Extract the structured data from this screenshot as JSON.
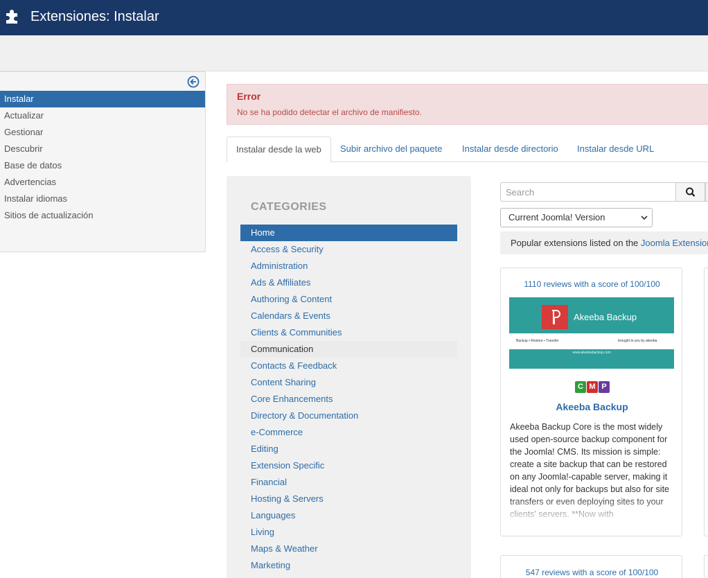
{
  "header": {
    "title": "Extensiones: Instalar",
    "icon": "puzzle-icon"
  },
  "sidebar": {
    "items": [
      {
        "label": "Instalar",
        "active": true
      },
      {
        "label": "Actualizar"
      },
      {
        "label": "Gestionar"
      },
      {
        "label": "Descubrir"
      },
      {
        "label": "Base de datos"
      },
      {
        "label": "Advertencias"
      },
      {
        "label": "Instalar idiomas"
      },
      {
        "label": "Sitios de actualización"
      }
    ]
  },
  "alert": {
    "title": "Error",
    "message": "No se ha podido detectar el archivo de manifiesto."
  },
  "tabs": [
    {
      "label": "Instalar desde la web",
      "active": true
    },
    {
      "label": "Subir archivo del paquete"
    },
    {
      "label": "Instalar desde directorio"
    },
    {
      "label": "Instalar desde URL"
    }
  ],
  "categories": {
    "heading": "CATEGORIES",
    "items": [
      "Home",
      "Access & Security",
      "Administration",
      "Ads & Affiliates",
      "Authoring & Content",
      "Calendars & Events",
      "Clients & Communities",
      "Communication",
      "Contacts & Feedback",
      "Content Sharing",
      "Core Enhancements",
      "Directory & Documentation",
      "e-Commerce",
      "Editing",
      "Extension Specific",
      "Financial",
      "Hosting & Servers",
      "Languages",
      "Living",
      "Maps & Weather",
      "Marketing"
    ]
  },
  "search": {
    "placeholder": "Search",
    "version_select": "Current Joomla! Version"
  },
  "popular": {
    "text": "Popular extensions listed on the ",
    "link": "Joomla Extensions Directory"
  },
  "cards": [
    {
      "reviews": "1110 reviews with a score of 100/100",
      "image": {
        "brand": "Akeeba Backup",
        "tagline": "Backup • Restore • Transfer",
        "credit": "brought to you by akeeba",
        "url": "www.akeebabackup.com"
      },
      "badges": [
        {
          "label": "C",
          "color": "#2e9e3a"
        },
        {
          "label": "M",
          "color": "#d12e2e"
        },
        {
          "label": "P",
          "color": "#6b3aa0"
        }
      ],
      "name": "Akeeba Backup",
      "description": "Akeeba Backup Core is the most widely used open-source backup component for the Joomla! CMS. Its mission is simple: create a site backup that can be restored on any Joomla!-capable server, making it ideal not only for backups but also for site transfers or even deploying sites to your clients' servers. **Now with"
    },
    {
      "reviews": "547 reviews with a score of 100/100"
    }
  ]
}
